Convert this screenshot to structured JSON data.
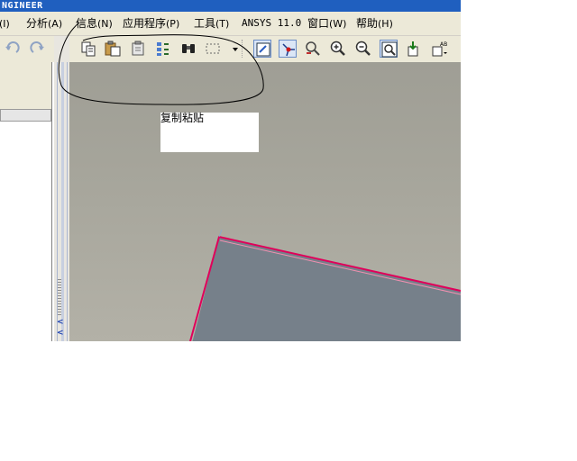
{
  "titlebar": {
    "text": "NGINEER"
  },
  "menu": {
    "items": [
      {
        "label": "",
        "acc": "(I)"
      },
      {
        "label": "分析",
        "acc": "(A)"
      },
      {
        "label": "信息",
        "acc": "(N)"
      },
      {
        "label": "应用程序",
        "acc": "(P)"
      },
      {
        "label": "工具",
        "acc": "(T)"
      },
      {
        "label": "ANSYS 11.0",
        "acc": ""
      },
      {
        "label": "窗口",
        "acc": "(W)"
      },
      {
        "label": "帮助",
        "acc": "(H)"
      }
    ]
  },
  "toolbar": {
    "icons": [
      "undo-icon",
      "redo-icon",
      "copy-icon",
      "paste-icon",
      "paste-special-icon",
      "reorder-icon",
      "find-icon",
      "select-box-icon",
      "repaint-icon",
      "spin-center-icon",
      "orient-icon",
      "zoom-in-icon",
      "zoom-out-icon",
      "refit-icon",
      "saved-view-icon",
      "annotation-display-icon"
    ]
  },
  "annotation": {
    "text": "复制粘贴"
  },
  "colors": {
    "titlebar": "#1f5fbf",
    "edge_highlight": "#e0005a",
    "part_fill": "#76808a",
    "annotation_ink": "#000000"
  }
}
